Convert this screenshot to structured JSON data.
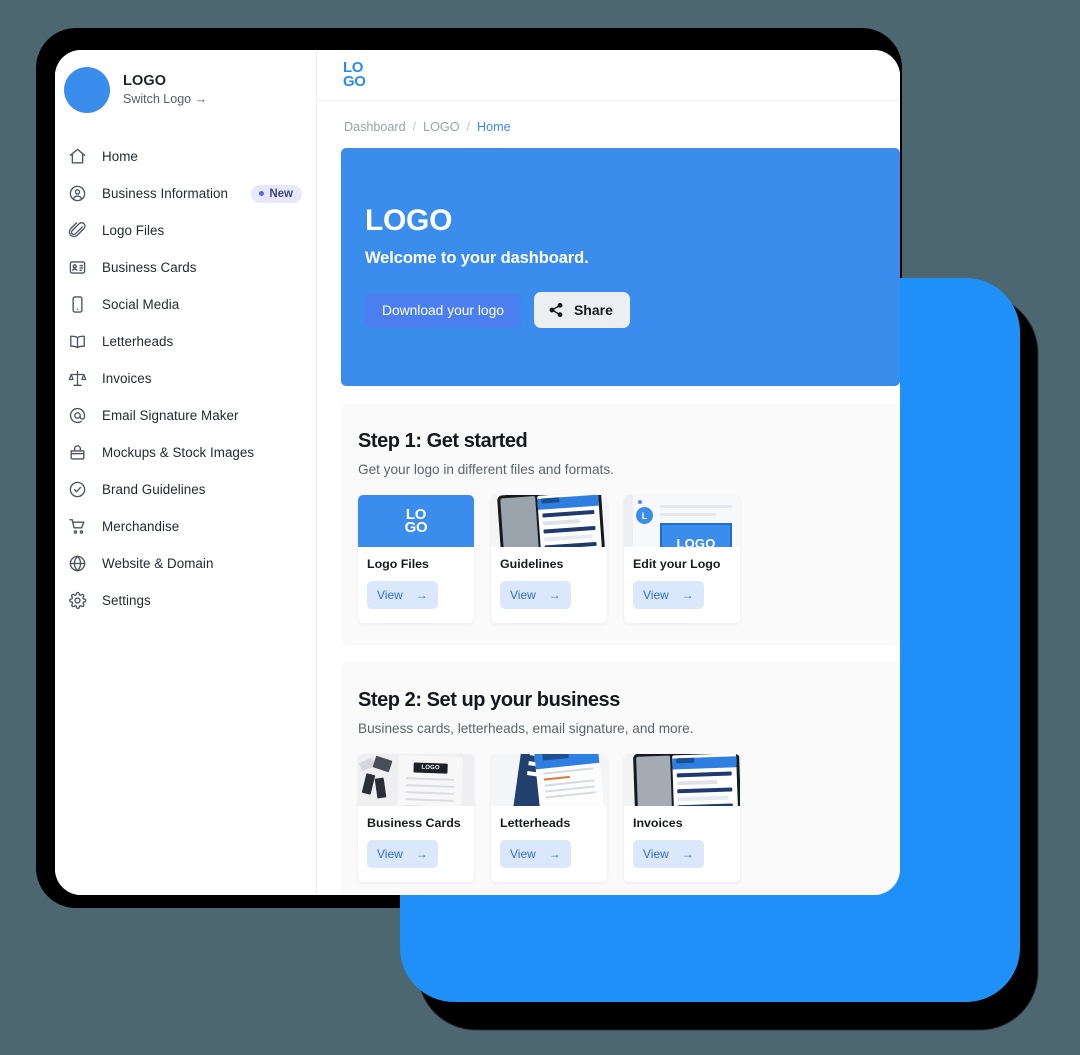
{
  "sidebar": {
    "brand": {
      "title": "LOGO",
      "switch_label": "Switch Logo →"
    },
    "items": [
      {
        "label": "Home",
        "icon": "home-icon"
      },
      {
        "label": "Business Information",
        "icon": "user-circle-icon",
        "badge": "New"
      },
      {
        "label": "Logo Files",
        "icon": "paperclip-icon"
      },
      {
        "label": "Business Cards",
        "icon": "id-card-icon"
      },
      {
        "label": "Social Media",
        "icon": "phone-icon"
      },
      {
        "label": "Letterheads",
        "icon": "book-icon"
      },
      {
        "label": "Invoices",
        "icon": "scales-icon"
      },
      {
        "label": "Email Signature Maker",
        "icon": "at-sign-icon"
      },
      {
        "label": "Mockups & Stock Images",
        "icon": "bag-icon"
      },
      {
        "label": "Brand Guidelines",
        "icon": "check-circle-icon"
      },
      {
        "label": "Merchandise",
        "icon": "shopping-cart-icon"
      },
      {
        "label": "Website & Domain",
        "icon": "globe-icon"
      },
      {
        "label": "Settings",
        "icon": "gear-icon"
      }
    ]
  },
  "topbar": {
    "logo_line1": "LO",
    "logo_line2": "GO"
  },
  "breadcrumb": {
    "items": [
      "Dashboard",
      "LOGO",
      "Home"
    ],
    "separator": "/"
  },
  "hero": {
    "title": "LOGO",
    "subtitle": "Welcome to your dashboard.",
    "download_label": "Download your logo",
    "share_label": "Share"
  },
  "steps": [
    {
      "title": "Step 1: Get started",
      "subtitle": "Get your logo in different files and formats.",
      "cards": [
        {
          "title": "Logo Files",
          "cta": "View",
          "arrow": "→",
          "thumb": "logo-tile-thumbnail"
        },
        {
          "title": "Guidelines",
          "cta": "View",
          "arrow": "→",
          "thumb": "tablet-guidelines-thumbnail"
        },
        {
          "title": "Edit your Logo",
          "cta": "View",
          "arrow": "→",
          "thumb": "logo-editor-thumbnail"
        }
      ]
    },
    {
      "title": "Step 2: Set up your business",
      "subtitle": "Business cards, letterheads, email signature, and more.",
      "cards": [
        {
          "title": "Business Cards",
          "cta": "View",
          "arrow": "→",
          "thumb": "business-cards-thumbnail"
        },
        {
          "title": "Letterheads",
          "cta": "View",
          "arrow": "→",
          "thumb": "letterheads-thumbnail"
        },
        {
          "title": "Invoices",
          "cta": "View",
          "arrow": "→",
          "thumb": "invoices-thumbnail"
        }
      ]
    }
  ],
  "thumb_text": {
    "logo_tile_line1": "LO",
    "logo_tile_line2": "GO",
    "editor_badge": "L",
    "editor_logo": "LOGO",
    "card_logo": "LOGO"
  },
  "colors": {
    "page_background": "#4d6771",
    "accent_blue": "#3b8ded",
    "card_blue": "#1f90f7",
    "badge_background": "#e7e9fb",
    "badge_dot": "#5b6ae0",
    "view_button_background": "#dbe8fb",
    "view_button_text": "#2d6fd4",
    "step_background": "#fafafb"
  }
}
